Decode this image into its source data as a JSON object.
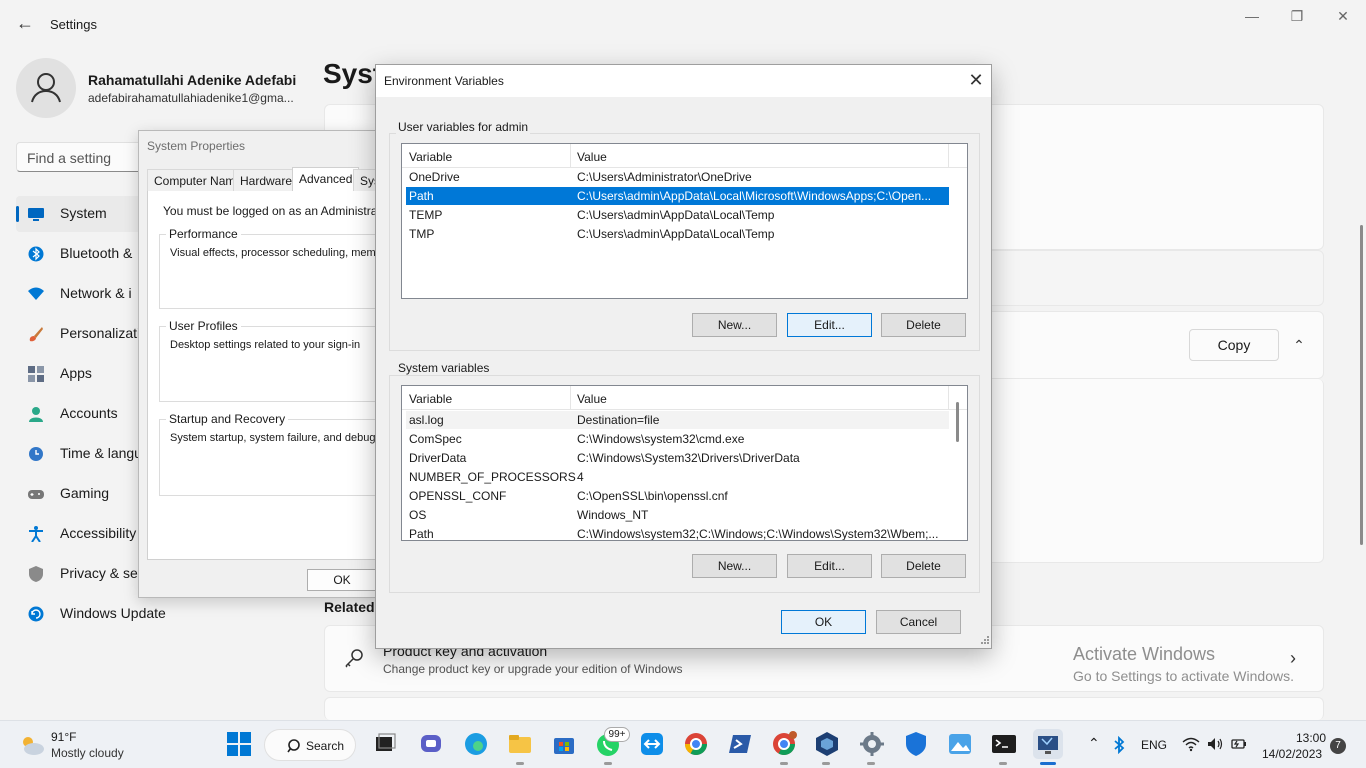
{
  "settings": {
    "title": "Settings",
    "window_controls": [
      "—",
      "❐",
      "✕"
    ],
    "user": {
      "name": "Rahamatullahi Adenike Adefabi",
      "email": "adefabirahamatullahiadenike1@gma..."
    },
    "search_placeholder": "Find a setting",
    "page_heading": "Syst",
    "nav": [
      {
        "label": "System",
        "selected": true,
        "icon": "monitor-icon",
        "color": "#0067c0"
      },
      {
        "label": "Bluetooth &",
        "icon": "bluetooth-icon",
        "color": "#0078d4"
      },
      {
        "label": "Network & i",
        "icon": "wifi-icon",
        "color": "#0078d4"
      },
      {
        "label": "Personalizati",
        "icon": "brush-icon",
        "color": "#e0613a"
      },
      {
        "label": "Apps",
        "icon": "apps-icon",
        "color": "#5e6c84"
      },
      {
        "label": "Accounts",
        "icon": "person-icon",
        "color": "#2aa889"
      },
      {
        "label": "Time & langu",
        "icon": "clock-globe-icon",
        "color": "#3277c8"
      },
      {
        "label": "Gaming",
        "icon": "gamepad-icon",
        "color": "#777"
      },
      {
        "label": "Accessibility",
        "icon": "accessibility-icon",
        "color": "#0078d4"
      },
      {
        "label": "Privacy & se",
        "icon": "shield-icon",
        "color": "#8a8a8a"
      },
      {
        "label": "Windows Update",
        "icon": "update-icon",
        "color": "#0078d4"
      }
    ],
    "copy_label": "Copy",
    "related_heading": "Related",
    "product_key": {
      "title": "Product key and activation",
      "subtitle": "Change product key or upgrade your edition of Windows"
    },
    "watermark": {
      "line1": "Activate Windows",
      "line2": "Go to Settings to activate Windows."
    }
  },
  "system_properties": {
    "title": "System Properties",
    "tabs": [
      "Computer Name",
      "Hardware",
      "Advanced",
      "Sys"
    ],
    "active_tab": "Advanced",
    "admin_note": "You must be logged on as an Administrator to",
    "groups": [
      {
        "title": "Performance",
        "text": "Visual effects, processor scheduling, memor"
      },
      {
        "title": "User Profiles",
        "text": "Desktop settings related to your sign-in"
      },
      {
        "title": "Startup and Recovery",
        "text": "System startup, system failure, and debuggin"
      }
    ],
    "ok_label": "OK"
  },
  "env_dialog": {
    "title": "Environment Variables",
    "user_group_label": "User variables for admin",
    "system_group_label": "System variables",
    "col_variable": "Variable",
    "col_value": "Value",
    "user_vars": [
      {
        "name": "OneDrive",
        "value": "C:\\Users\\Administrator\\OneDrive"
      },
      {
        "name": "Path",
        "value": "C:\\Users\\admin\\AppData\\Local\\Microsoft\\WindowsApps;C:\\Open...",
        "selected": true
      },
      {
        "name": "TEMP",
        "value": "C:\\Users\\admin\\AppData\\Local\\Temp"
      },
      {
        "name": "TMP",
        "value": "C:\\Users\\admin\\AppData\\Local\\Temp"
      }
    ],
    "system_vars": [
      {
        "name": "asl.log",
        "value": "Destination=file"
      },
      {
        "name": "ComSpec",
        "value": "C:\\Windows\\system32\\cmd.exe"
      },
      {
        "name": "DriverData",
        "value": "C:\\Windows\\System32\\Drivers\\DriverData"
      },
      {
        "name": "NUMBER_OF_PROCESSORS",
        "value": "4"
      },
      {
        "name": "OPENSSL_CONF",
        "value": "C:\\OpenSSL\\bin\\openssl.cnf"
      },
      {
        "name": "OS",
        "value": "Windows_NT"
      },
      {
        "name": "Path",
        "value": "C:\\Windows\\system32;C:\\Windows;C:\\Windows\\System32\\Wbem;..."
      }
    ],
    "new_label": "New...",
    "edit_label": "Edit...",
    "delete_label": "Delete",
    "ok_label": "OK",
    "cancel_label": "Cancel"
  },
  "taskbar": {
    "weather_temp": "91°F",
    "weather_desc": "Mostly cloudy",
    "search_label": "Search",
    "whatsapp_badge": "99+",
    "lang": "ENG",
    "time": "13:00",
    "date": "14/02/2023",
    "notification_count": "7"
  }
}
